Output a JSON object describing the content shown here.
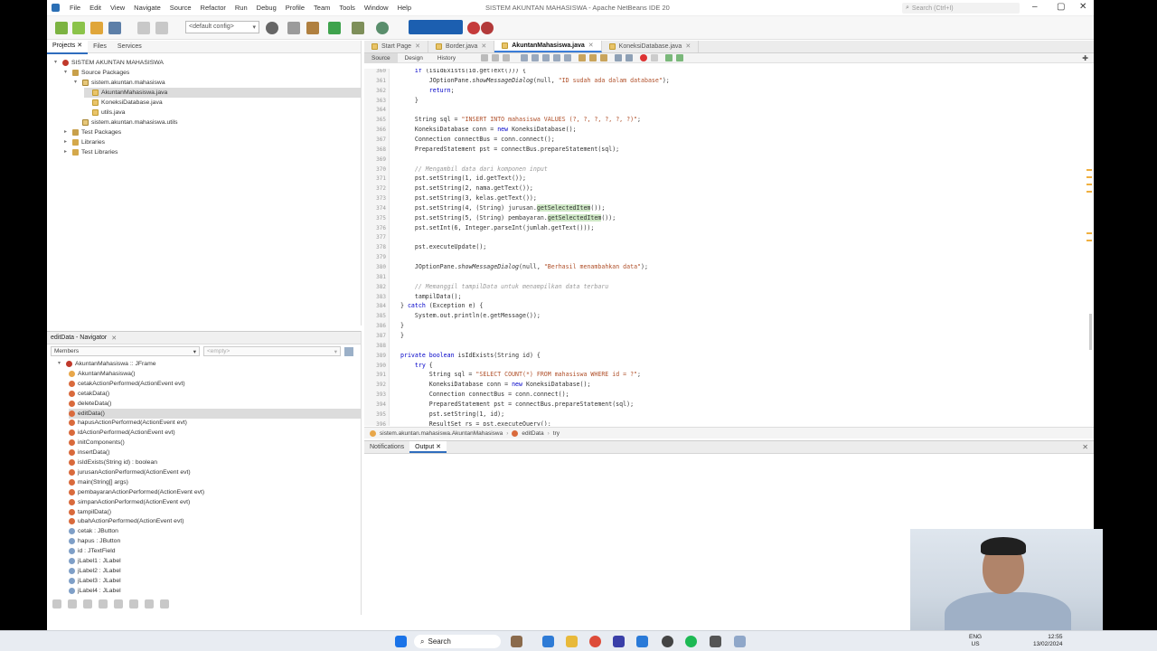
{
  "window": {
    "title": "SISTEM AKUNTAN MAHASISWA - Apache NetBeans IDE 20",
    "search_placeholder": "Search (Ctrl+I)"
  },
  "menu": [
    "File",
    "Edit",
    "View",
    "Navigate",
    "Source",
    "Refactor",
    "Run",
    "Debug",
    "Profile",
    "Team",
    "Tools",
    "Window",
    "Help"
  ],
  "toolbar": {
    "config": "<default config>"
  },
  "projects": {
    "tabs": [
      "Projects",
      "Files",
      "Services"
    ],
    "tree": [
      {
        "label": "SISTEM AKUNTAN MAHASISWA",
        "icon": "project-icon",
        "depth": 0,
        "toggle": "-"
      },
      {
        "label": "Source Packages",
        "icon": "folder-icon",
        "depth": 1,
        "toggle": "-"
      },
      {
        "label": "sistem.akuntan.mahasiswa",
        "icon": "package-icon",
        "depth": 2,
        "toggle": "-"
      },
      {
        "label": "AkuntanMahasiswa.java",
        "icon": "java-file-icon",
        "depth": 3,
        "toggle": "",
        "selected": true
      },
      {
        "label": "KoneksiDatabase.java",
        "icon": "java-file-icon",
        "depth": 3,
        "toggle": ""
      },
      {
        "label": "utils.java",
        "icon": "java-file-icon",
        "depth": 3,
        "toggle": ""
      },
      {
        "label": "sistem.akuntan.mahasiswa.utils",
        "icon": "package-icon",
        "depth": 2,
        "toggle": ""
      },
      {
        "label": "Test Packages",
        "icon": "folder-icon",
        "depth": 1,
        "toggle": "+"
      },
      {
        "label": "Libraries",
        "icon": "library-icon",
        "depth": 1,
        "toggle": "+"
      },
      {
        "label": "Test Libraries",
        "icon": "library-icon",
        "depth": 1,
        "toggle": "+"
      }
    ]
  },
  "navigator": {
    "title": "editData - Navigator",
    "filter": "Members",
    "empty": "<empty>",
    "items": [
      {
        "label": "AkuntanMahasiswa :: JFrame",
        "kind": "class",
        "depth": 0
      },
      {
        "label": "AkuntanMahasiswa()",
        "kind": "ctor",
        "depth": 1
      },
      {
        "label": "cetakActionPerformed(ActionEvent evt)",
        "kind": "method",
        "depth": 1
      },
      {
        "label": "cetakData()",
        "kind": "method",
        "depth": 1
      },
      {
        "label": "deleteData()",
        "kind": "method",
        "depth": 1
      },
      {
        "label": "editData()",
        "kind": "method",
        "depth": 1,
        "selected": true
      },
      {
        "label": "hapusActionPerformed(ActionEvent evt)",
        "kind": "method",
        "depth": 1
      },
      {
        "label": "idActionPerformed(ActionEvent evt)",
        "kind": "method",
        "depth": 1
      },
      {
        "label": "initComponents()",
        "kind": "method",
        "depth": 1
      },
      {
        "label": "insertData()",
        "kind": "method",
        "depth": 1
      },
      {
        "label": "isIdExists(String id) : boolean",
        "kind": "method",
        "depth": 1
      },
      {
        "label": "jurusanActionPerformed(ActionEvent evt)",
        "kind": "method",
        "depth": 1
      },
      {
        "label": "main(String[] args)",
        "kind": "method",
        "depth": 1
      },
      {
        "label": "pembayaranActionPerformed(ActionEvent evt)",
        "kind": "method",
        "depth": 1
      },
      {
        "label": "simpanActionPerformed(ActionEvent evt)",
        "kind": "method",
        "depth": 1
      },
      {
        "label": "tampilData()",
        "kind": "method",
        "depth": 1
      },
      {
        "label": "ubahActionPerformed(ActionEvent evt)",
        "kind": "method",
        "depth": 1
      },
      {
        "label": "cetak : JButton",
        "kind": "field",
        "depth": 1
      },
      {
        "label": "hapus : JButton",
        "kind": "field",
        "depth": 1
      },
      {
        "label": "id : JTextField",
        "kind": "field",
        "depth": 1
      },
      {
        "label": "jLabel1 : JLabel",
        "kind": "field",
        "depth": 1
      },
      {
        "label": "jLabel2 : JLabel",
        "kind": "field",
        "depth": 1
      },
      {
        "label": "jLabel3 : JLabel",
        "kind": "field",
        "depth": 1
      },
      {
        "label": "jLabel4 : JLabel",
        "kind": "field",
        "depth": 1
      }
    ]
  },
  "editor": {
    "tabs": [
      {
        "label": "Start Page",
        "active": false
      },
      {
        "label": "Border.java",
        "active": false
      },
      {
        "label": "AkuntanMahasiswa.java",
        "active": true
      },
      {
        "label": "KoneksiDatabase.java",
        "active": false
      }
    ],
    "views": [
      "Source",
      "Design",
      "History"
    ],
    "lines": [
      {
        "n": "360",
        "code": "    if (isIdExists(id.getText())) {"
      },
      {
        "n": "361",
        "code": "        JOptionPane.showMessageDialog(null, \"ID sudah ada dalam database\");"
      },
      {
        "n": "362",
        "code": "        return;"
      },
      {
        "n": "363",
        "code": "    }"
      },
      {
        "n": "364",
        "code": ""
      },
      {
        "n": "365",
        "code": "    String sql = \"INSERT INTO mahasiswa VALUES (?, ?, ?, ?, ?, ?)\";"
      },
      {
        "n": "366",
        "code": "    KoneksiDatabase conn = new KoneksiDatabase();"
      },
      {
        "n": "367",
        "code": "    Connection connectBus = conn.connect();"
      },
      {
        "n": "368",
        "code": "    PreparedStatement pst = connectBus.prepareStatement(sql);"
      },
      {
        "n": "369",
        "code": ""
      },
      {
        "n": "370",
        "code": "    // Mengambil data dari komponen input"
      },
      {
        "n": "371",
        "code": "    pst.setString(1, id.getText());"
      },
      {
        "n": "372",
        "code": "    pst.setString(2, nama.getText());"
      },
      {
        "n": "373",
        "code": "    pst.setString(3, kelas.getText());"
      },
      {
        "n": "374",
        "code": "    pst.setString(4, (String) jurusan.getSelectedItem());"
      },
      {
        "n": "375",
        "code": "    pst.setString(5, (String) pembayaran.getSelectedItem());"
      },
      {
        "n": "376",
        "code": "    pst.setInt(6, Integer.parseInt(jumlah.getText()));"
      },
      {
        "n": "377",
        "code": ""
      },
      {
        "n": "378",
        "code": "    pst.executeUpdate();"
      },
      {
        "n": "379",
        "code": ""
      },
      {
        "n": "380",
        "code": "    JOptionPane.showMessageDialog(null, \"Berhasil menambahkan data\");"
      },
      {
        "n": "381",
        "code": ""
      },
      {
        "n": "382",
        "code": "    // Memanggil tampilData untuk menampilkan data terbaru"
      },
      {
        "n": "383",
        "code": "    tampilData();"
      },
      {
        "n": "384",
        "code": "} catch (Exception e) {"
      },
      {
        "n": "385",
        "code": "    System.out.println(e.getMessage());"
      },
      {
        "n": "386",
        "code": "}"
      },
      {
        "n": "387",
        "code": "}"
      },
      {
        "n": "388",
        "code": ""
      },
      {
        "n": "389",
        "code": "private boolean isIdExists(String id) {"
      },
      {
        "n": "390",
        "code": "    try {"
      },
      {
        "n": "391",
        "code": "        String sql = \"SELECT COUNT(*) FROM mahasiswa WHERE id = ?\";"
      },
      {
        "n": "392",
        "code": "        KoneksiDatabase conn = new KoneksiDatabase();"
      },
      {
        "n": "393",
        "code": "        Connection connectBus = conn.connect();"
      },
      {
        "n": "394",
        "code": "        PreparedStatement pst = connectBus.prepareStatement(sql);"
      },
      {
        "n": "395",
        "code": "        pst.setString(1, id);"
      },
      {
        "n": "396",
        "code": "        ResultSet rs = pst.executeQuery();"
      }
    ],
    "breadcrumbs": [
      "sistem.akuntan.mahasiswa.AkuntanMahasiswa",
      "editData",
      "try"
    ]
  },
  "output": {
    "tabs": [
      "Notifications",
      "Output"
    ]
  },
  "taskbar": {
    "search": "Search",
    "lang1": "ENG",
    "lang2": "US",
    "time": "12:55",
    "date": "13/02/2024"
  }
}
